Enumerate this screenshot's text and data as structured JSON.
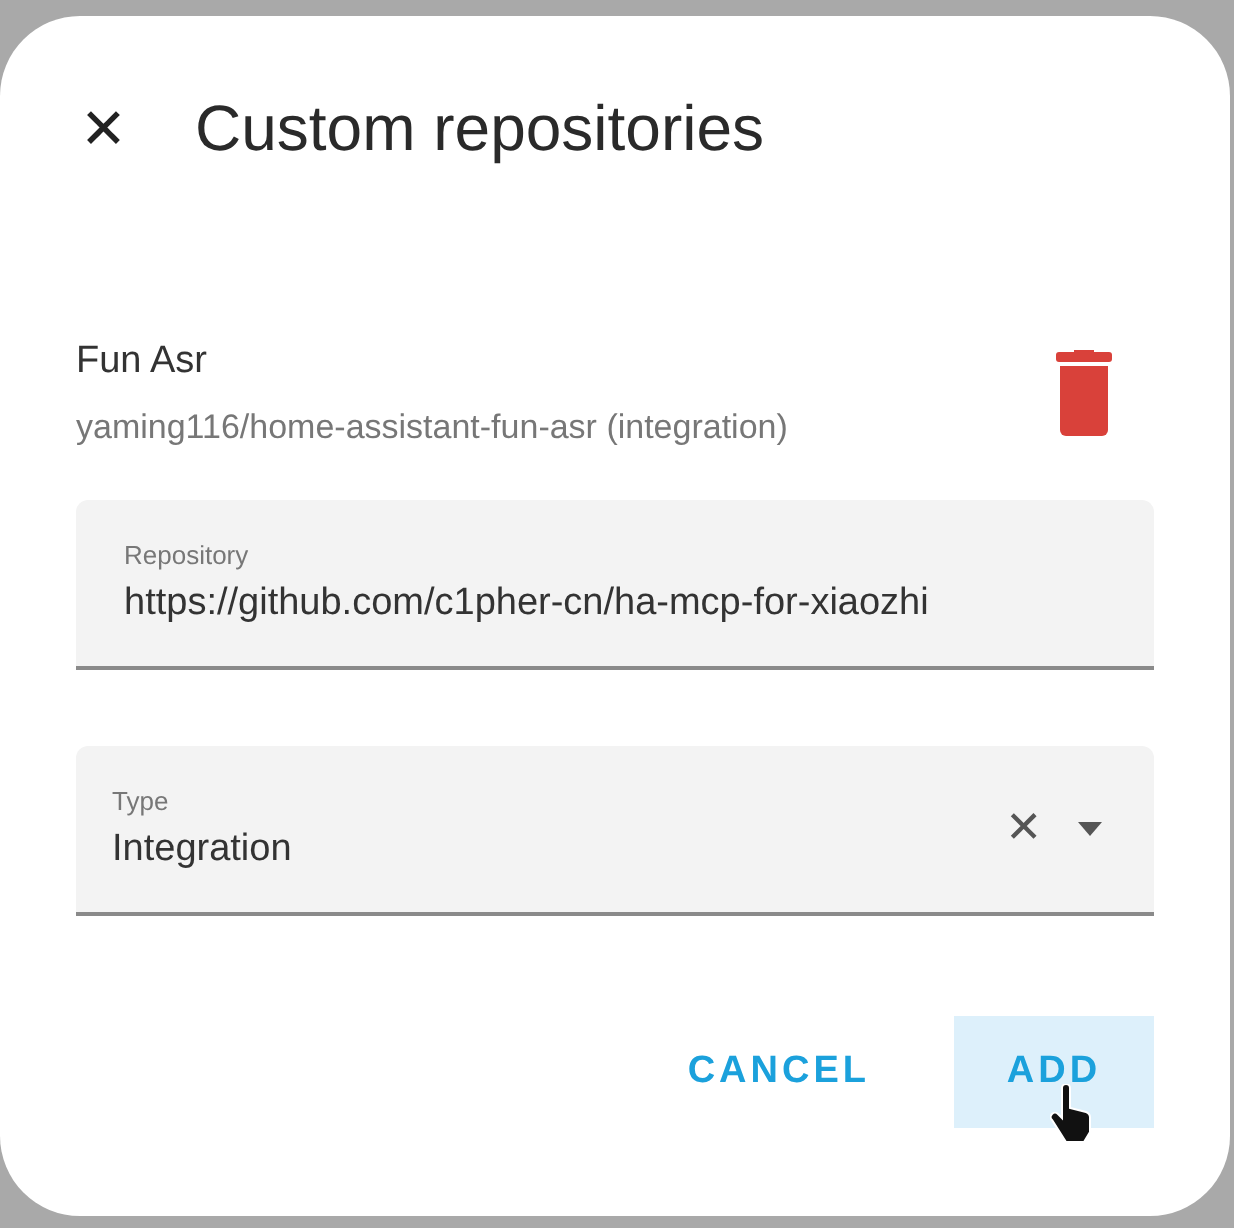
{
  "dialog": {
    "title": "Custom repositories",
    "close_icon": "✕"
  },
  "repositories": [
    {
      "name": "Fun Asr",
      "detail": "yaming116/home-assistant-fun-asr (integration)"
    }
  ],
  "repository_field": {
    "label": "Repository",
    "value": "https://github.com/c1pher-cn/ha-mcp-for-xiaozhi"
  },
  "type_field": {
    "label": "Type",
    "value": "Integration",
    "clear_icon": "✕"
  },
  "buttons": [
    {
      "label": "CANCEL",
      "highlighted": false
    },
    {
      "label": "ADD",
      "highlighted": true
    }
  ]
}
